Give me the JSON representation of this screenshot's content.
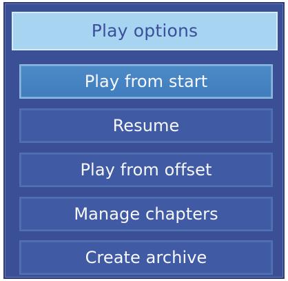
{
  "dialog": {
    "title": "Play options",
    "items": [
      {
        "label": "Play from start",
        "selected": true
      },
      {
        "label": "Resume",
        "selected": false
      },
      {
        "label": "Play from offset",
        "selected": false
      },
      {
        "label": "Manage chapters",
        "selected": false
      },
      {
        "label": "Create archive",
        "selected": false
      }
    ]
  },
  "colors": {
    "panel": "#3a4f95",
    "title_bar": "#a7d5f1",
    "selected_item": "#4d8ac6",
    "item": "#405ba3",
    "item_text": "#f7f8fc",
    "title_text": "#3b4f9a"
  }
}
